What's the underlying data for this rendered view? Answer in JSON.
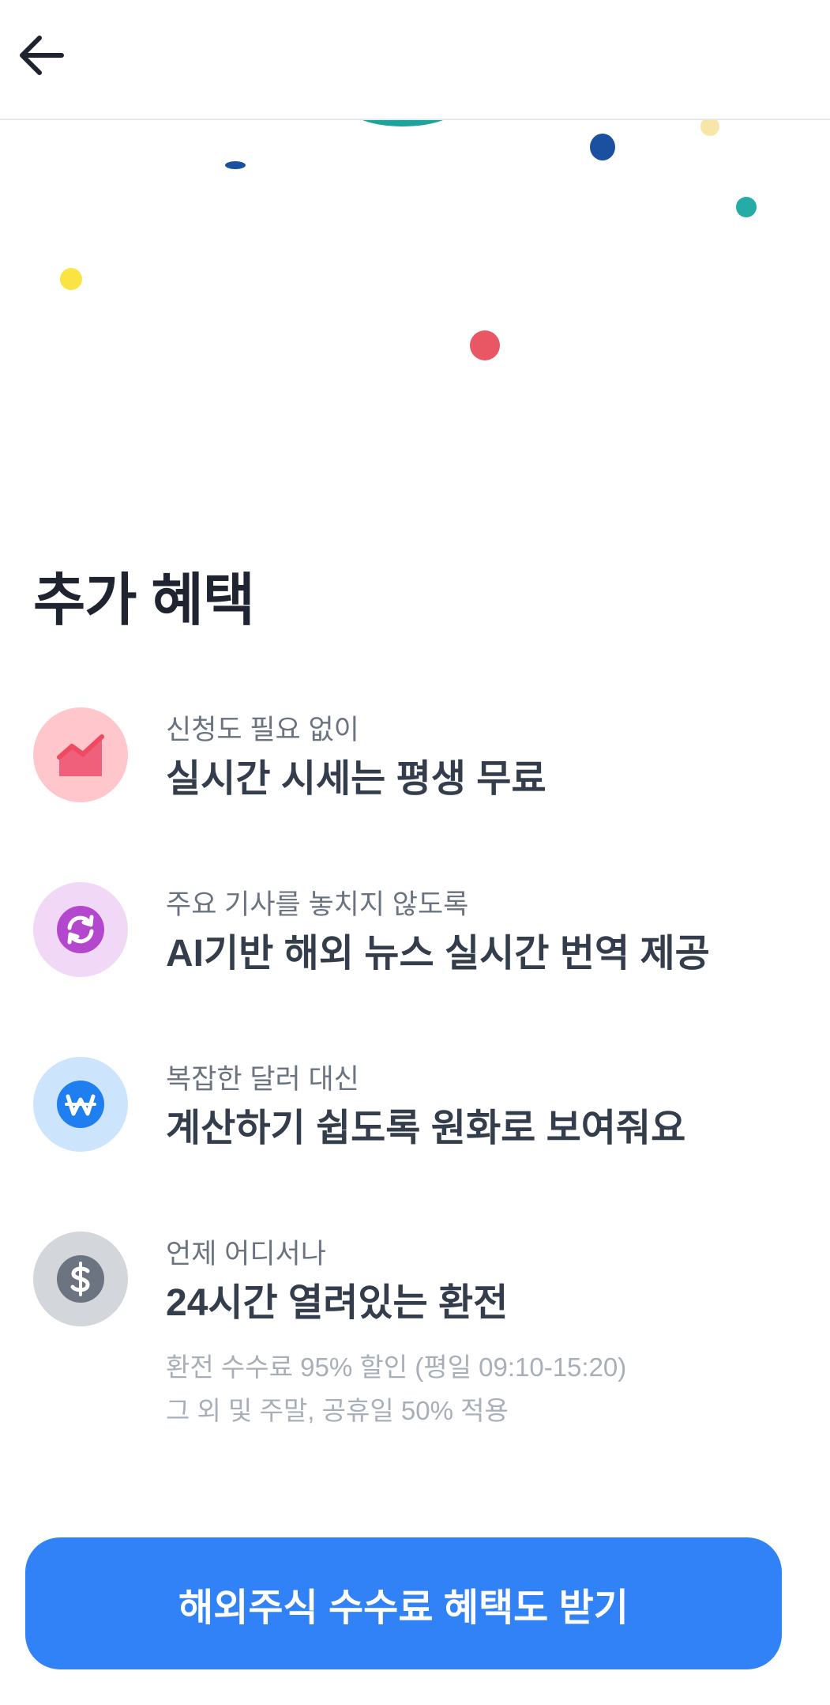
{
  "header": {
    "back_icon": "arrow-left-icon"
  },
  "section_title": "추가 혜택",
  "benefits": [
    {
      "icon": "chart-icon",
      "icon_bg": "#ffc6cc",
      "icon_color": "#f0607a",
      "subtitle": "신청도 필요 없이",
      "title": "실시간 시세는 평생 무료"
    },
    {
      "icon": "refresh-icon",
      "icon_bg": "#f1d8f6",
      "icon_color": "#b348cf",
      "subtitle": "주요 기사를 놓치지 않도록",
      "title": "AI기반 해외 뉴스 실시간 번역 제공"
    },
    {
      "icon": "won-icon",
      "icon_bg": "#cde5fc",
      "icon_color": "#1f7ff0",
      "subtitle": "복잡한 달러 대신",
      "title": "계산하기 쉽도록 원화로 보여줘요"
    },
    {
      "icon": "dollar-icon",
      "icon_bg": "#d3d6da",
      "icon_color": "#6b7480",
      "subtitle": "언제 어디서나",
      "title": "24시간 열려있는 환전",
      "notes": [
        "환전 수수료 95% 할인 (평일 09:10-15:20)",
        "그 외 및 주말, 공휴일 50% 적용"
      ]
    }
  ],
  "cta_label": "해외주식 수수료 혜택도 받기",
  "colors": {
    "accent": "#3182f6",
    "title": "#1f2430",
    "subtitle": "#6b7380",
    "note": "#a8afb8"
  }
}
